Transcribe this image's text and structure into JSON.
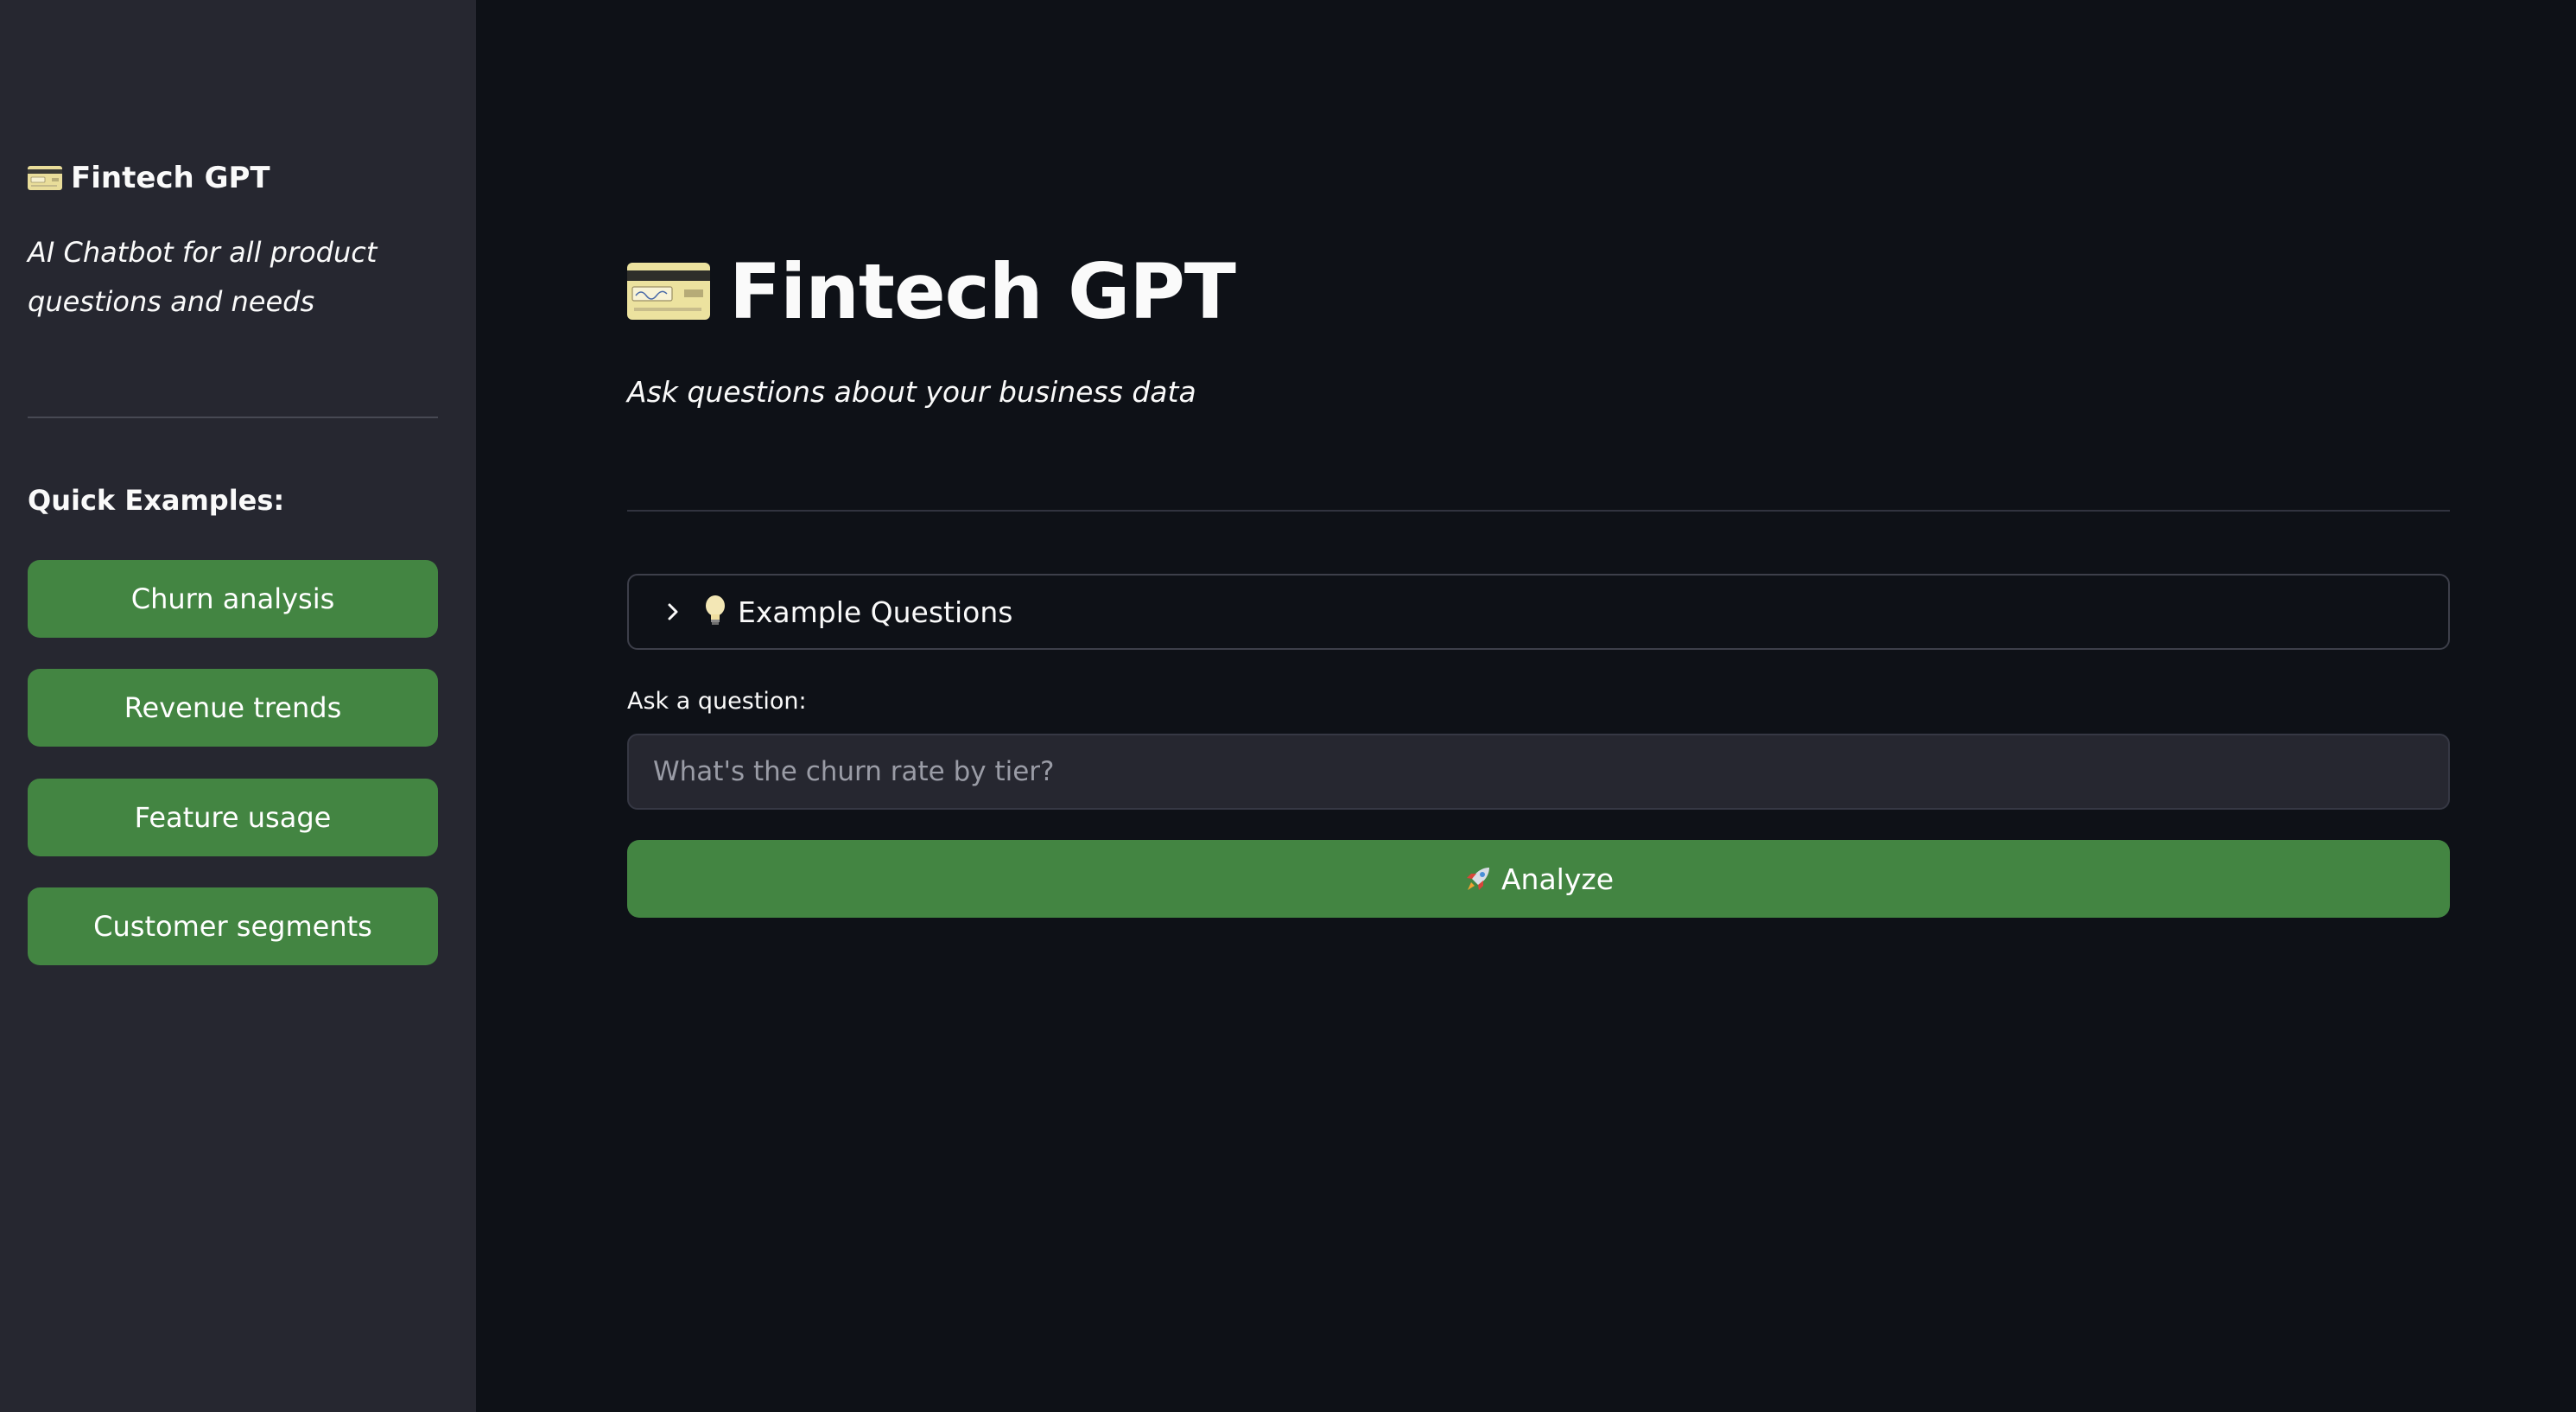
{
  "sidebar": {
    "title": "Fintech GPT",
    "title_icon": "credit-card-icon",
    "subtitle": "AI Chatbot for all product questions and needs",
    "quick_examples_heading": "Quick Examples:",
    "buttons": [
      {
        "label": "Churn analysis"
      },
      {
        "label": "Revenue trends"
      },
      {
        "label": "Feature usage"
      },
      {
        "label": "Customer segments"
      }
    ]
  },
  "main": {
    "title": "Fintech GPT",
    "title_icon": "credit-card-icon",
    "subtitle": "Ask questions about your business data",
    "expander": {
      "label": "Example Questions",
      "icon": "lightbulb-icon",
      "expanded": false
    },
    "question": {
      "label": "Ask a question:",
      "value": "",
      "placeholder": "What's the churn rate by tier?"
    },
    "analyze_button": {
      "label": "Analyze",
      "icon": "rocket-icon"
    }
  },
  "colors": {
    "background": "#0e1117",
    "sidebar_background": "#262730",
    "button_green": "#438542",
    "text": "#fafafa"
  }
}
